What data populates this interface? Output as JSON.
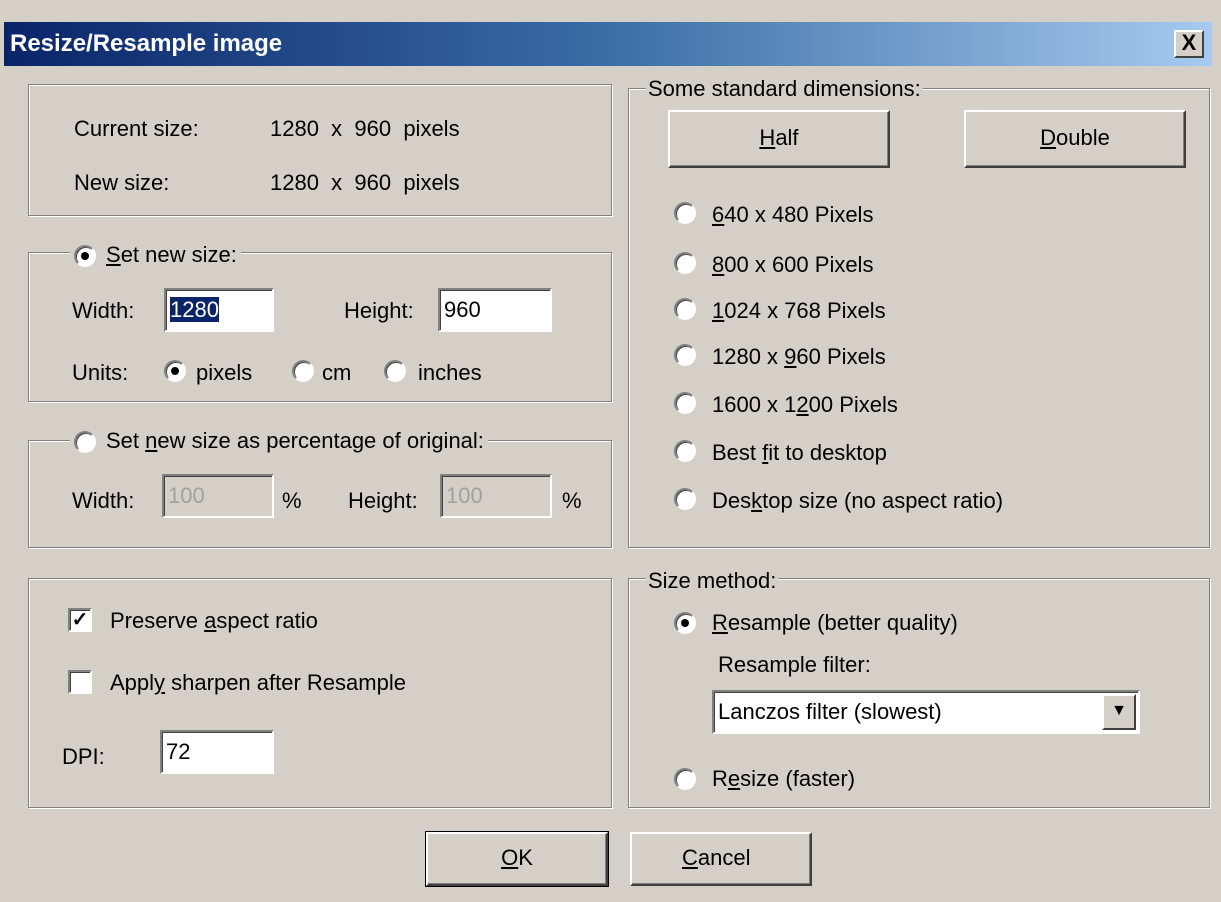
{
  "window": {
    "title": "Resize/Resample image",
    "close_label": "X"
  },
  "sizes": {
    "current_label": "Current size:",
    "current_value": "1280  x  960  pixels",
    "new_label": "New size:",
    "new_value": "1280  x  960  pixels"
  },
  "set_new_size": {
    "label_prefix": "",
    "label_key": "S",
    "label_rest": "et new size:",
    "width_label": "Width:",
    "width_value": "1280",
    "height_label": "Height:",
    "height_value": "960",
    "units_label": "Units:",
    "unit_pixels": "pixels",
    "unit_cm": "cm",
    "unit_inches": "inches"
  },
  "percentage": {
    "label_prefix": "Set ",
    "label_key": "n",
    "label_rest": "ew size as percentage of original:",
    "width_label": "Width:",
    "width_value": "100",
    "width_unit": "%",
    "height_label": "Height:",
    "height_value": "100",
    "height_unit": "%"
  },
  "options": {
    "preserve_prefix": "Preserve ",
    "preserve_key": "a",
    "preserve_rest": "spect ratio",
    "sharpen_prefix": "Appl",
    "sharpen_key": "y",
    "sharpen_rest": " sharpen after Resample",
    "dpi_label": "DPI:",
    "dpi_value": "72"
  },
  "standard": {
    "legend": "Some standard dimensions:",
    "half_key": "H",
    "half_rest": "alf",
    "double_key": "D",
    "double_rest": "ouble",
    "opt1_key": "6",
    "opt1_rest": "40 x 480 Pixels",
    "opt2_key": "8",
    "opt2_rest": "00 x 600 Pixels",
    "opt3_key": "1",
    "opt3_rest": "024 x 768 Pixels",
    "opt4_prefix": "1280 x ",
    "opt4_key": "9",
    "opt4_rest": "60 Pixels",
    "opt5_prefix": "1600 x 1",
    "opt5_key": "2",
    "opt5_rest": "00 Pixels",
    "opt6_prefix": "Best ",
    "opt6_key": "f",
    "opt6_rest": "it to desktop",
    "opt7_prefix": "Des",
    "opt7_key": "k",
    "opt7_rest": "top size (no aspect ratio)"
  },
  "method": {
    "legend": "Size method:",
    "resample_key": "R",
    "resample_rest": "esample (better quality)",
    "filter_label": "Resample filter:",
    "filter_value": "Lanczos filter (slowest)",
    "resize_prefix": "R",
    "resize_key": "e",
    "resize_rest": "size (faster)"
  },
  "buttons": {
    "ok_key": "O",
    "ok_rest": "K",
    "cancel_key": "C",
    "cancel_rest": "ancel"
  },
  "icons": {
    "dropdown": "▼"
  }
}
